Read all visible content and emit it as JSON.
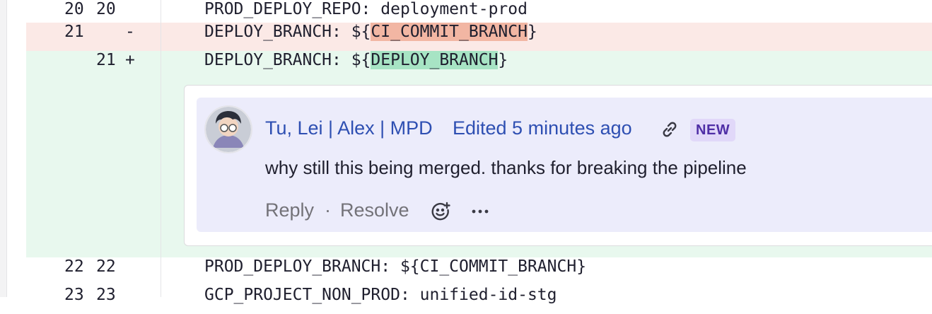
{
  "diff": {
    "rows": [
      {
        "old": "20",
        "new": "20",
        "sign": "",
        "pre": "PROD_DEPLOY_REPO: deployment-prod",
        "hl": "",
        "post": ""
      },
      {
        "old": "21",
        "new": "",
        "sign": "-",
        "pre": "DEPLOY_BRANCH: ${",
        "hl": "CI_COMMIT_BRANCH",
        "post": "}"
      },
      {
        "old": "",
        "new": "21",
        "sign": "+",
        "pre": "DEPLOY_BRANCH: ${",
        "hl": "DEPLOY_BRANCH",
        "post": "}"
      },
      {
        "old": "22",
        "new": "22",
        "sign": "",
        "pre": "PROD_DEPLOY_BRANCH: ${CI_COMMIT_BRANCH}",
        "hl": "",
        "post": ""
      },
      {
        "old": "23",
        "new": "23",
        "sign": "",
        "pre": "GCP_PROJECT_NON_PROD: unified-id-stg",
        "hl": "",
        "post": ""
      }
    ]
  },
  "comment": {
    "author": "Tu, Lei | Alex | MPD",
    "edited": "Edited 5 minutes ago",
    "badge": "NEW",
    "body": "why still this being merged. thanks for breaking the pipeline",
    "reply_label": "Reply",
    "separator": "·",
    "resolve_label": "Resolve",
    "icons": [
      "link-icon",
      "emoji-icon",
      "more-icon"
    ]
  },
  "colors": {
    "deleted_row": "#fbe9e6",
    "added_row": "#e8f8ee",
    "deleted_highlight": "#f2b6a3",
    "added_highlight": "#a7e4c4",
    "link": "#2e4fb2",
    "badge_bg": "#e1d8f9"
  }
}
